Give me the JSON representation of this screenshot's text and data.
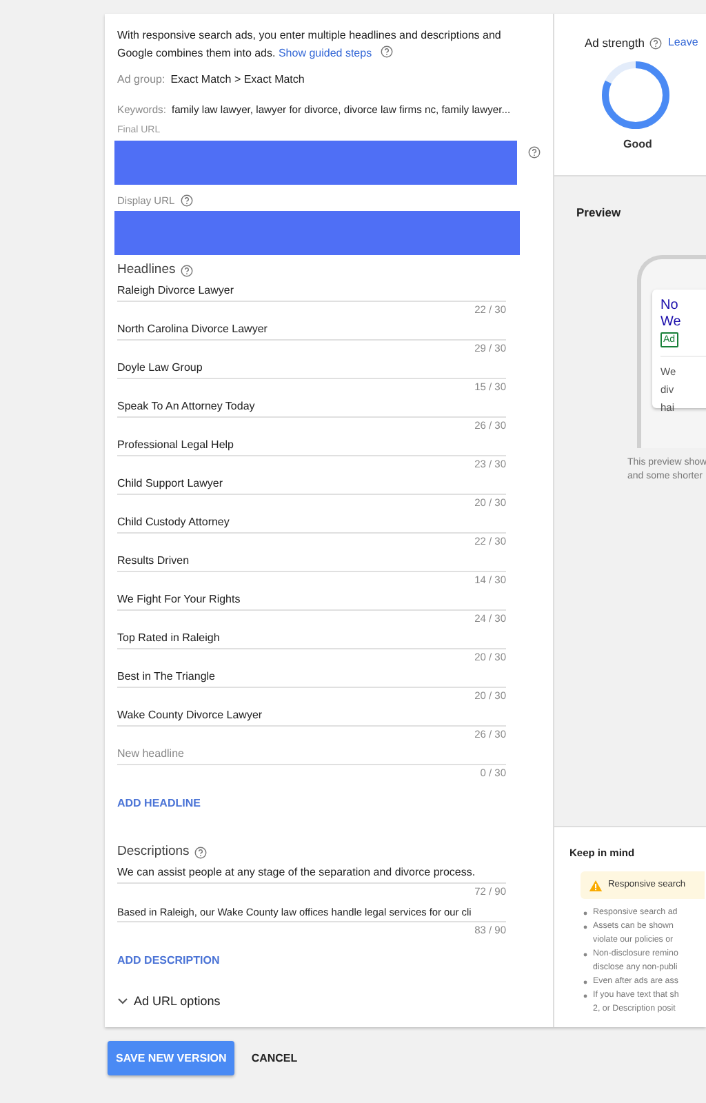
{
  "intro": {
    "text": "With responsive search ads, you enter multiple headlines and descriptions and Google combines them into ads.",
    "link": "Show guided steps"
  },
  "ad_group": {
    "label": "Ad group:",
    "value": "Exact Match > Exact Match"
  },
  "keywords": {
    "label": "Keywords:",
    "value": "family law lawyer, lawyer for divorce, divorce law firms nc, family lawyer..."
  },
  "final_url": {
    "label": "Final URL"
  },
  "display_url": {
    "label": "Display URL"
  },
  "headlines": {
    "title": "Headlines",
    "add": "ADD HEADLINE",
    "items": [
      {
        "text": "Raleigh Divorce Lawyer",
        "count": "22 / 30",
        "empty": false
      },
      {
        "text": "North Carolina Divorce Lawyer",
        "count": "29 / 30",
        "empty": false
      },
      {
        "text": "Doyle Law Group",
        "count": "15 / 30",
        "empty": false
      },
      {
        "text": "Speak To An Attorney Today",
        "count": "26 / 30",
        "empty": false
      },
      {
        "text": "Professional Legal Help",
        "count": "23 / 30",
        "empty": false
      },
      {
        "text": "Child Support Lawyer",
        "count": "20 / 30",
        "empty": false
      },
      {
        "text": "Child Custody Attorney",
        "count": "22 / 30",
        "empty": false
      },
      {
        "text": "Results Driven",
        "count": "14 / 30",
        "empty": false
      },
      {
        "text": "We Fight For Your Rights",
        "count": "24 / 30",
        "empty": false
      },
      {
        "text": "Top Rated in Raleigh",
        "count": "20 / 30",
        "empty": false
      },
      {
        "text": "Best in The Triangle",
        "count": "20 / 30",
        "empty": false
      },
      {
        "text": "Wake County Divorce Lawyer",
        "count": "26 / 30",
        "empty": false
      },
      {
        "text": "New headline",
        "count": "0 / 30",
        "empty": true
      }
    ]
  },
  "descriptions": {
    "title": "Descriptions",
    "add": "ADD DESCRIPTION",
    "items": [
      {
        "text": "We can assist people at any stage of the separation and divorce process.",
        "count": "72 / 90"
      },
      {
        "text": "Based in Raleigh, our Wake County law offices handle legal services for our cli",
        "count": "83 / 90"
      }
    ]
  },
  "url_options": {
    "label": "Ad URL options",
    "expanded": false
  },
  "ad_strength": {
    "title": "Ad strength",
    "link": "Leave",
    "rating": "Good",
    "level": 0.82
  },
  "preview": {
    "title": "Preview",
    "headline_lines": [
      "No",
      "We"
    ],
    "badge": "Ad",
    "description_lines": [
      "We",
      "div",
      "hai"
    ],
    "note_lines": [
      "This preview show",
      "and some shorter"
    ]
  },
  "keep_in_mind": {
    "title": "Keep in mind",
    "warning": "Responsive search",
    "bullets": [
      {
        "lines": [
          "Responsive search ad"
        ]
      },
      {
        "lines": [
          "Assets can be shown",
          "violate our policies or"
        ]
      },
      {
        "lines": [
          "Non-disclosure remino",
          "disclose any non-publi"
        ]
      },
      {
        "lines": [
          "Even after ads are ass"
        ]
      },
      {
        "lines": [
          "If you have text that sh",
          "2, or Description posit"
        ]
      }
    ]
  },
  "buttons": {
    "save": "SAVE NEW VERSION",
    "cancel": "CANCEL"
  }
}
